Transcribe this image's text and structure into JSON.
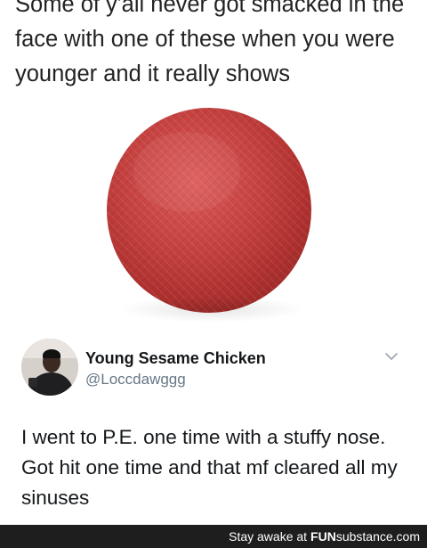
{
  "caption": {
    "text": "Some of y'all never got smacked in the face with one of these when you were younger and it really shows"
  },
  "image": {
    "subject_icon": "red-playground-ball",
    "ball_color": "#c23b3b"
  },
  "tweet": {
    "display_name": "Young Sesame Chicken",
    "handle": "@Loccdawggg",
    "body": "I went to P.E. one time with a stuffy nose. Got hit one time and that mf cleared all my sinuses",
    "menu_icon": "chevron-down-icon"
  },
  "watermark": {
    "prefix": "Stay awake at",
    "site_bold": "FUN",
    "site_rest": "substance.com"
  },
  "colors": {
    "footer_bg": "#1e1e1e",
    "handle_gray": "#657786"
  }
}
